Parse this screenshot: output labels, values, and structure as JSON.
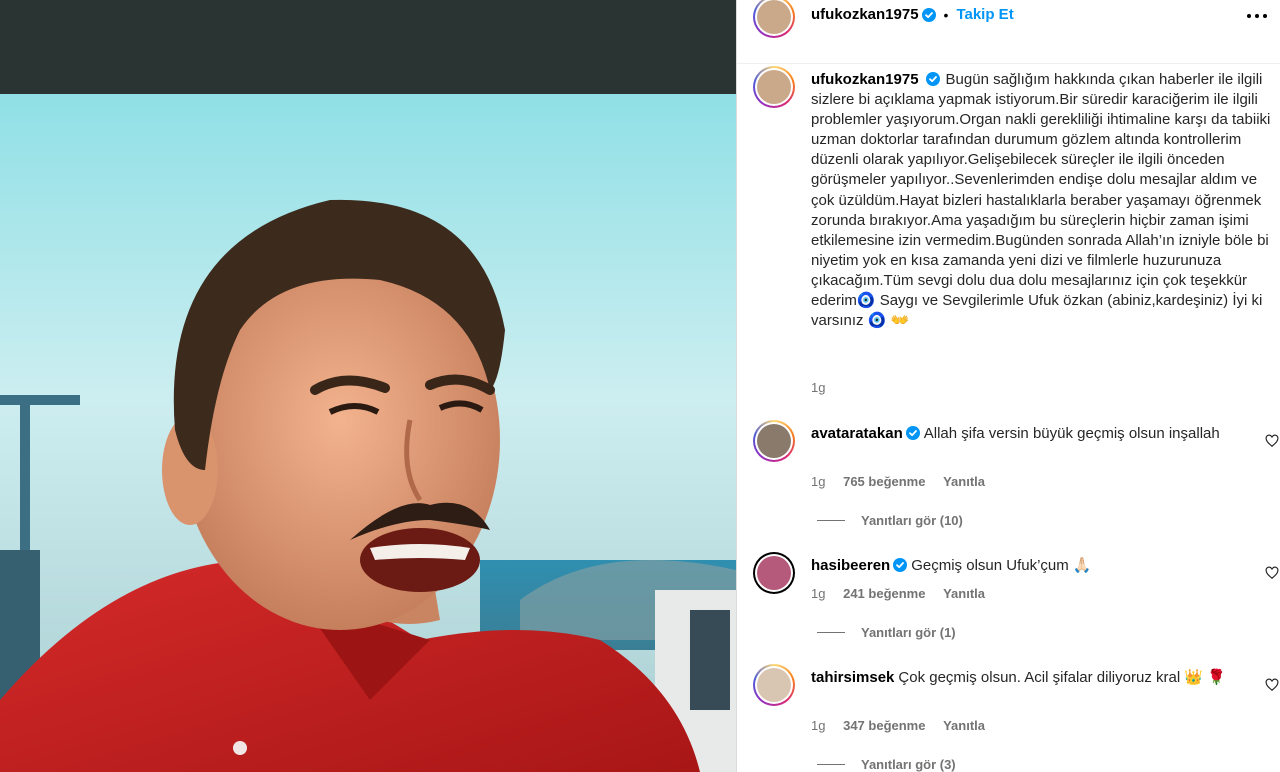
{
  "post": {
    "username": "ufukozkan1975",
    "follow_label": "Takip Et",
    "caption": "Bugün sağlığım hakkında çıkan haberler ile ilgili sizlere bi açıklama yapmak istiyorum.Bir süredir karaciğerim ile ilgili problemler yaşıyorum.Organ nakli gerekliliği ihtimaline karşı da tabiiki uzman doktorlar tarafından durumum gözlem altında kontrollerim düzenli olarak yapılıyor.Gelişebilecek süreçler ile ilgili önceden görüşmeler yapılıyor..Sevenlerimden endişe dolu mesajlar aldım ve çok üzüldüm.Hayat bizleri hastalıklarla beraber yaşamayı öğrenmek zorunda bırakıyor.Ama yaşadığım bu süreçlerin hiçbir zaman işimi etkilemesine izin vermedim.Bugünden sonrada Allah’ın izniyle böle bi niyetim yok en kısa zamanda yeni dizi ve filmlerle huzurunuza çıkacağım.Tüm sevgi dolu dua dolu mesajlarınız için çok teşekkür ederim🧿 Saygı ve Sevgilerimle Ufuk özkan (abiniz,kardeşiniz) İyi ki varsınız 🧿 👐",
    "time": "1g"
  },
  "comments": [
    {
      "username": "avataratakan",
      "text": "Allah şifa versin büyük geçmiş olsun inşallah",
      "time": "1g",
      "likes": "765 beğenme",
      "reply_label": "Yanıtla",
      "view_replies": "Yanıtları gör (10)"
    },
    {
      "username": "hasibeeren",
      "text": "Geçmiş olsun Ufuk’çum 🙏🏻",
      "time": "1g",
      "likes": "241 beğenme",
      "reply_label": "Yanıtla",
      "view_replies": "Yanıtları gör (1)"
    },
    {
      "username": "tahirsimsek",
      "text": "Çok geçmiş olsun. Acil şifalar diliyoruz kral 👑 🌹",
      "time": "1g",
      "likes": "347 beğenme",
      "reply_label": "Yanıtla",
      "view_replies": "Yanıtları gör (3)"
    }
  ],
  "icons": {
    "verified": "verified-badge-icon",
    "more": "more-options-icon",
    "like": "heart-icon"
  },
  "colors": {
    "accent": "#0095f6",
    "secondary_text": "#737373"
  }
}
